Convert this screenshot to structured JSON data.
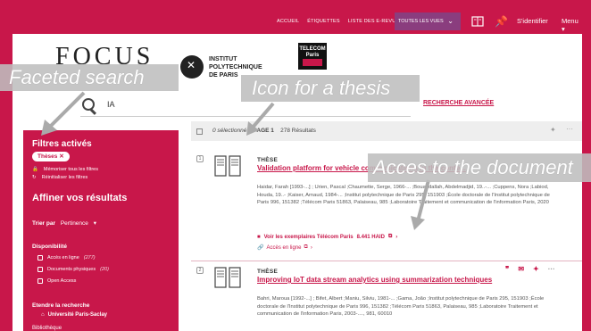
{
  "nav": {
    "links": [
      "ACCUEIL",
      "ÉTIQUETTES",
      "LISTE DES E-REVUES"
    ],
    "views_label": "TOUTES LES VUES",
    "signin": "S'identifier",
    "menu": "Menu ▾"
  },
  "logos": {
    "focus": "FOCUS",
    "ipp": [
      "INSTITUT",
      "POLYTECHNIQUE",
      "DE PARIS"
    ],
    "telecom": [
      "TELECOM",
      "Paris"
    ]
  },
  "callouts": {
    "faceted": "Faceted search",
    "icon": "Icon for a thesis",
    "acces": "Acces to the document"
  },
  "search": {
    "query": "IA",
    "advanced": "RECHERCHE AVANCÉE"
  },
  "sidebar": {
    "title": "Filtres activés",
    "chip": "Thèses ✕",
    "memo": "Mémoriser tous les filtres",
    "reset": "Réinitialiser les filtres",
    "refine": "Affiner vos résultats",
    "sort_label": "Trier par",
    "sort_value": "Pertinence",
    "dispo": "Disponibilité",
    "options": [
      {
        "label": "Accès en ligne",
        "count": "(277)"
      },
      {
        "label": "Documents physiques",
        "count": "(20)"
      },
      {
        "label": "Open Access",
        "count": ""
      }
    ],
    "extend": "Etendre la recherche",
    "university": "Université Paris-Saclay",
    "more": "Bibliothèque"
  },
  "results_header": {
    "selected": "0 sélectionné",
    "page": "PAGE 1",
    "count": "278 Résultats"
  },
  "results": [
    {
      "num": "1",
      "type": "THÈSE",
      "title": "Validation platform for vehicle communications in the conte...",
      "authors": "Haidar, Farah [1993-...] ; Urien, Pascal ;Chaumette, Serge, 1966-... ;Bouabdallah, Abdelmadjid, 19..-... ;Cuppens, Nora ;Labiod, Houda, 19..- ;Kaiser, Arnaud, 1984-... ;Institut polytechnique de Paris 295, 151903 ;École doctorale de l'Institut polytechnique de Paris 996, 151382 ;Télécom Paris 51863, Palaiseau, 985 ;Laboratoire Traitement et communication de l'information Paris, 2020",
      "avail": "Voir les exemplaires Télécom Paris",
      "haid": "8.441 HAID",
      "online": "Accès en ligne"
    },
    {
      "num": "2",
      "type": "THÈSE",
      "title": "Improving IoT data stream analytics using summarization techniques",
      "authors": "Bahri, Maroua [1992-...] ; Bifet, Albert ;Maniu, Silviu, 1981-... ;Gama, João ;Institut polytechnique de Paris 295, 151903 ;École doctorale de l'Institut polytechnique de Paris 996, 151382 ;Télécom Paris 51863, Palaiseau, 985 ;Laboratoire Traitement et communication de l'information Paris, 2003-...., 981, 60010"
    }
  ]
}
